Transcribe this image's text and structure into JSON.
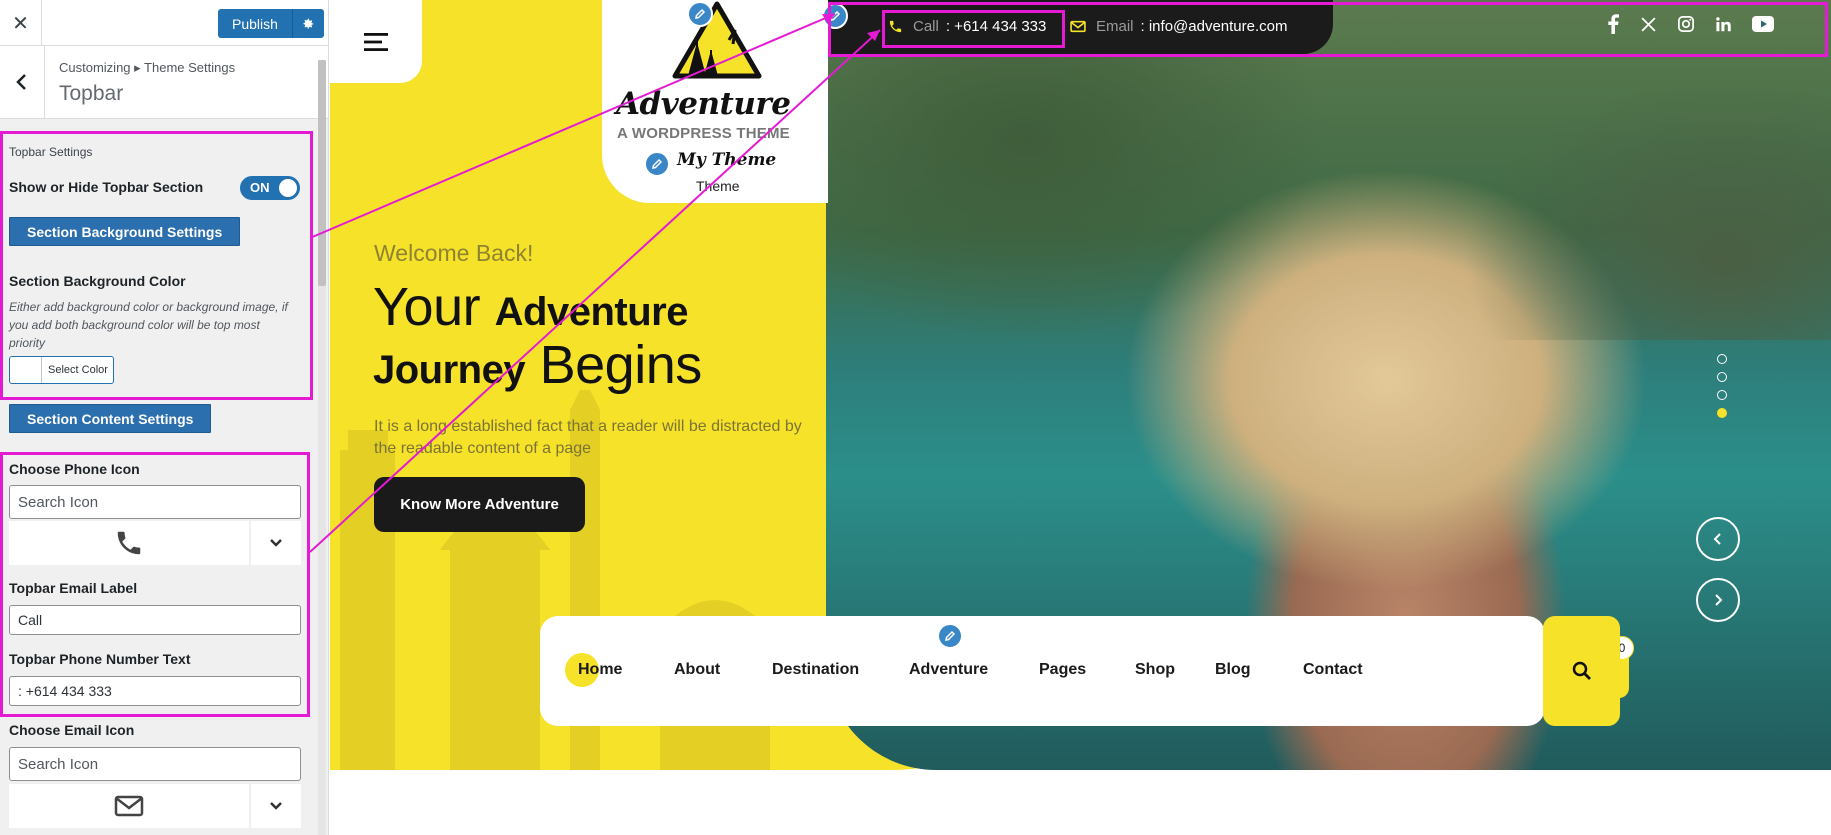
{
  "panel": {
    "close_icon": "close-icon",
    "publish_label": "Publish",
    "breadcrumb": "Customizing ▸ Theme Settings",
    "title": "Topbar",
    "topbar_settings_heading": "Topbar Settings",
    "show_hide_label": "Show or Hide Topbar Section",
    "toggle_value": "ON",
    "section_bg_button": "Section Background Settings",
    "bg_color_label": "Section Background Color",
    "bg_color_desc": "Either add background color or background image, if you add both background color will be top most priority",
    "select_color_label": "Select Color",
    "section_content_button": "Section Content Settings",
    "phone_icon_label": "Choose Phone Icon",
    "phone_icon_search_placeholder": "Search Icon",
    "email_label_field_label": "Topbar Email Label",
    "email_label_value": "Call",
    "phone_text_label": "Topbar Phone Number Text",
    "phone_text_value": ": +614 434 333",
    "email_icon_label": "Choose Email Icon",
    "email_icon_search_placeholder": "Search Icon"
  },
  "preview": {
    "logo": {
      "title": "Adventure",
      "subtitle": "A WORDPRESS THEME",
      "tagline": "My Theme",
      "site_desc": "Theme"
    },
    "topbar": {
      "call_label": "Call",
      "call_value": ": +614 434 333",
      "email_label": "Email",
      "email_value": ": info@adventure.com",
      "socials": [
        "facebook-icon",
        "x-icon",
        "instagram-icon",
        "linkedin-icon",
        "youtube-icon"
      ]
    },
    "hero": {
      "welcome": "Welcome Back!",
      "headline_line1_light": "Your ",
      "headline_line1_bold": "Adventure",
      "headline_line2_bold": "Journey",
      "headline_line2_light": " Begins",
      "description": "It is a long established fact that a reader will be distracted by the readable content of a page",
      "cta": "Know More Adventure",
      "slides_count": 4,
      "active_slide": 4
    },
    "nav": {
      "items": [
        "Home",
        "About",
        "Destination",
        "Adventure",
        "Pages",
        "Shop",
        "Blog",
        "Contact"
      ],
      "cart_count": "0"
    }
  },
  "colors": {
    "accent_yellow": "#f7e22a",
    "highlight_magenta": "#e41bd3",
    "wp_blue": "#2271b1",
    "dark": "#1b1b1b"
  }
}
